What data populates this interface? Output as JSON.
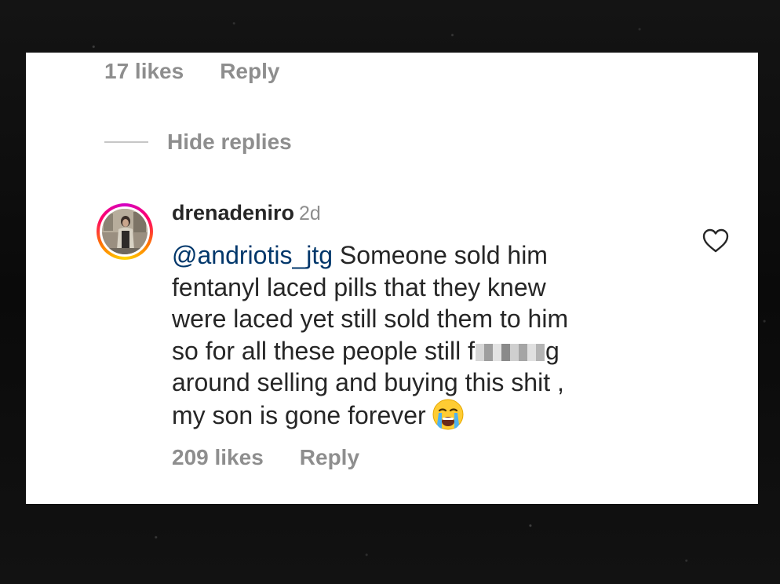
{
  "thread": {
    "parent_likes": "17 likes",
    "parent_reply": "Reply",
    "hide_replies": "Hide replies"
  },
  "reply": {
    "username": "drenadeniro",
    "time_ago": "2d",
    "mention": "@andriotis_jtg",
    "lines": [
      " Someone sold him",
      "fentanyl laced pills that they knew",
      "were laced yet still sold them to him",
      "so for all these people still f",
      "g",
      "around selling and buying this shit ,",
      "my son is gone forever"
    ],
    "likes": "209 likes",
    "reply_label": "Reply"
  },
  "icons": {
    "like": "heart-outline-icon",
    "emoji": "loudly-crying-face-emoji"
  },
  "colors": {
    "mention": "#00376b",
    "muted": "#8e8e8e",
    "text": "#262626"
  }
}
